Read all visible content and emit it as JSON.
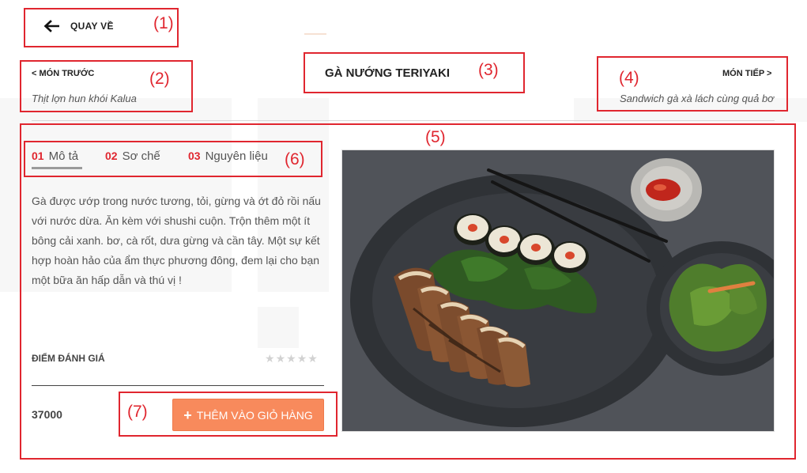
{
  "back_button": {
    "label": "QUAY VỀ",
    "icon": "arrow-left-icon"
  },
  "prev_dish": {
    "label": "< MÓN TRƯỚC",
    "name": "Thịt lợn hun khói Kalua"
  },
  "dish": {
    "title": "GÀ NƯỚNG TERIYAKI"
  },
  "next_dish": {
    "label": "MÓN TIẾP >",
    "name": "Sandwich gà xà lách cùng quả bơ"
  },
  "tabs": [
    {
      "num": "01",
      "label": "Mô tả"
    },
    {
      "num": "02",
      "label": "Sơ chế"
    },
    {
      "num": "03",
      "label": "Nguyên liệu"
    }
  ],
  "description": "Gà được ướp trong nước tương, tỏi, gừng và ớt đỏ rồi nấu với nước dừa.  Ăn kèm với shushi cuộn. Trộn thêm một ít bông cải xanh. bơ, cà rốt, dưa gừng và cần tây. Một sự kết hợp hoàn hảo của ẩm thực phương đông, đem lại cho bạn một bữa ăn hấp dẫn và thú vị !",
  "rating": {
    "label": "ĐIỂM ĐÁNH GIÁ",
    "stars_filled": 0,
    "stars_total": 5
  },
  "price": "37000",
  "cart_button": {
    "label": "THÊM VÀO GIỎ HÀNG",
    "icon": "plus-icon"
  },
  "annotations": [
    "(1)",
    "(2)",
    "(3)",
    "(4)",
    "(5)",
    "(6)",
    "(7)"
  ],
  "colors": {
    "accent": "#e0262f",
    "button": "#f88a5c",
    "annotation": "#e0262f"
  }
}
